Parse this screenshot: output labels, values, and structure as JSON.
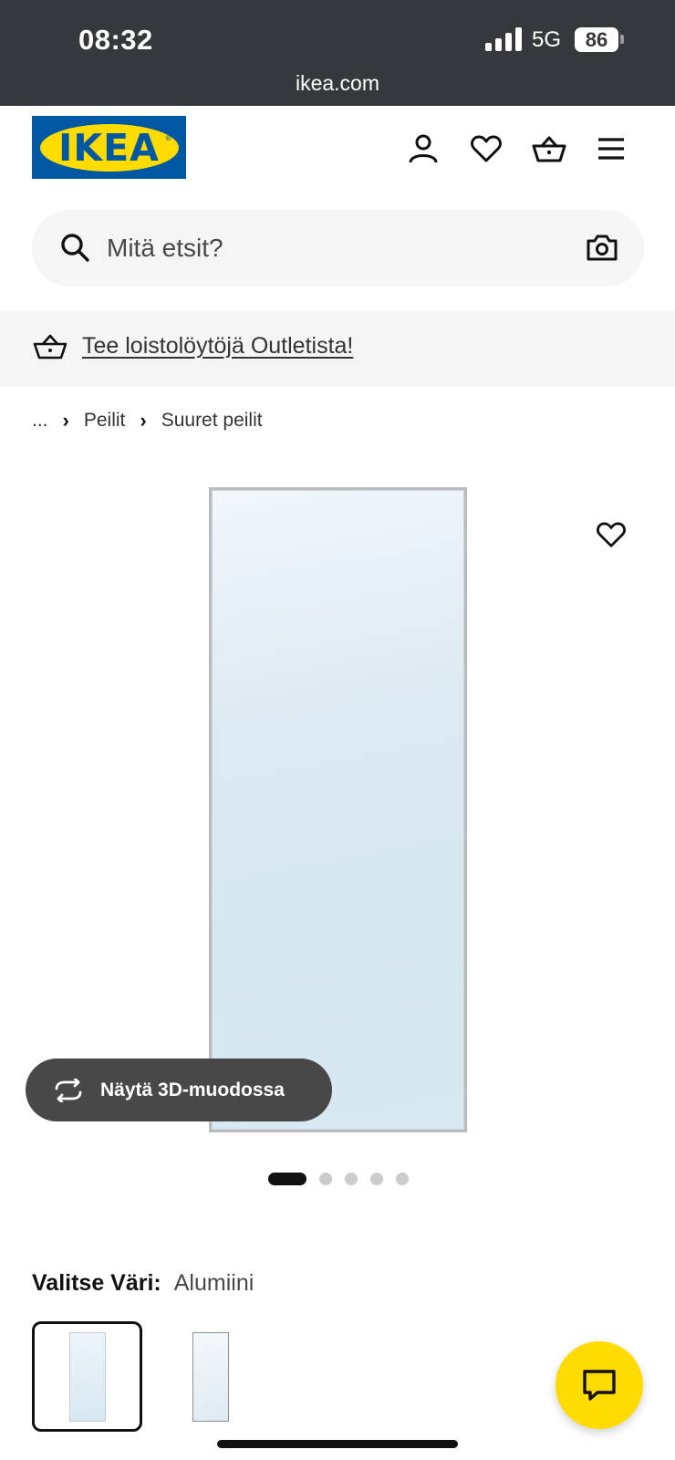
{
  "status_bar": {
    "time": "08:32",
    "network": "5G",
    "battery": "86",
    "url": "ikea.com"
  },
  "header": {
    "logo_text": "IKEA",
    "logo_colors": {
      "background": "#0058a3",
      "oval": "#ffdb00"
    },
    "icons": [
      "user-icon",
      "heart-icon",
      "basket-icon",
      "menu-icon"
    ]
  },
  "search": {
    "placeholder": "Mitä etsit?",
    "value": ""
  },
  "banner": {
    "link_text": "Tee loistolöytöjä Outletista!"
  },
  "breadcrumb": {
    "items": [
      "...",
      "Peilit",
      "Suuret peilit"
    ]
  },
  "gallery": {
    "button_3d_label": "Näytä 3D-muodossa",
    "image_count": 5,
    "active_index": 0
  },
  "color": {
    "label": "Valitse Väri:",
    "value": "Alumiini",
    "options_count": 2,
    "selected_index": 0
  },
  "accent_colors": {
    "ikea_blue": "#0058a3",
    "ikea_yellow": "#ffdb00",
    "dark_button": "#484848"
  }
}
